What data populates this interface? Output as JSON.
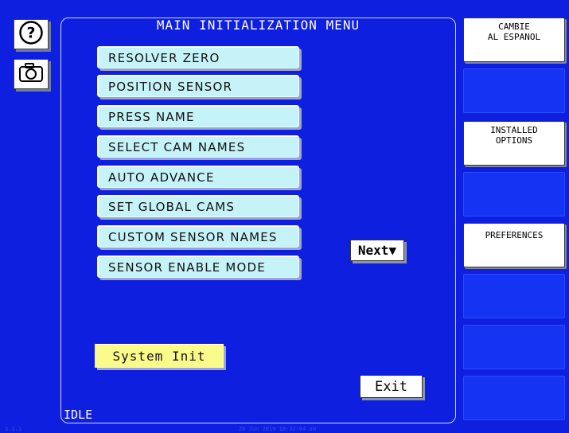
{
  "title": "MAIN INITIALIZATION MENU",
  "menu_items": [
    "RESOLVER ZERO",
    "POSITION SENSOR",
    "PRESS NAME",
    "SELECT CAM NAMES",
    "AUTO ADVANCE",
    "SET GLOBAL CAMS",
    "CUSTOM SENSOR NAMES",
    "SENSOR ENABLE MODE"
  ],
  "next_label": "Next▼",
  "system_init_label": "System Init",
  "exit_label": "Exit",
  "status": "IDLE",
  "side_keys": {
    "k1": "CAMBIE\nAL ESPANOL",
    "k3": "INSTALLED\nOPTIONS",
    "k5": "PREFERENCES"
  },
  "footer": {
    "version": "3.3.1",
    "datetime": "26 Jun 2019 10:32:04 am"
  },
  "icons": {
    "help": "help-icon",
    "camera": "camera-icon"
  },
  "colors": {
    "background": "#0f1fe0",
    "menu_button": "#c6f3f8",
    "system_init": "#fbfb8c"
  }
}
